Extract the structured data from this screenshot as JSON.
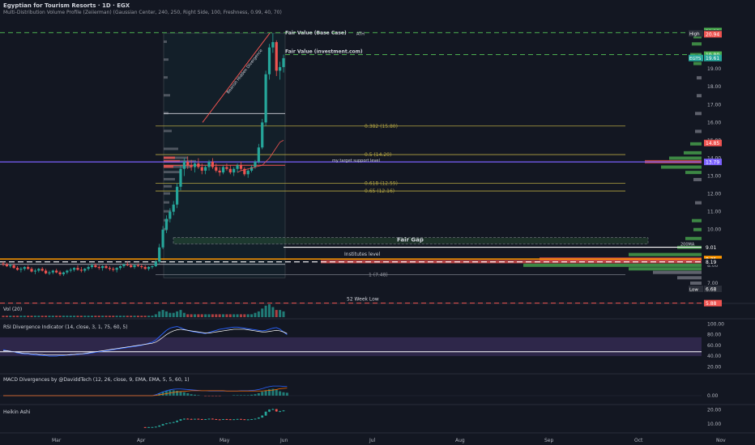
{
  "header": {
    "title": "Egyptian for Tourism Resorts · 1D · EGX",
    "indicator": "Multi-Distribution Volume Profile (Zeiierman) (Gaussian Center, 240, 250, Right Side, 100, Freshness, 0.99, 40, 70)"
  },
  "colors": {
    "background": "#131722",
    "up": "#26a69a",
    "down": "#ef5350",
    "fib": "#b5a642",
    "purple_line": "#7b61ff",
    "orange_line": "#ff9800",
    "green_dash": "#4caf50",
    "red_dash": "#ef5350"
  },
  "chart_data": [
    {
      "type": "candlestick",
      "panel": "price",
      "x_tick_labels": [
        "Mar",
        "Apr",
        "May",
        "Jun",
        "Jul",
        "Aug",
        "Sep",
        "Oct",
        "Nov"
      ],
      "ylim": [
        6.0,
        21.5
      ],
      "y_ticks": [
        7.0,
        8.0,
        9.0,
        10.0,
        11.0,
        12.0,
        13.0,
        14.0,
        15.0,
        16.0,
        17.0,
        18.0,
        19.0
      ],
      "candles": [
        [
          8.1,
          8.2,
          7.95,
          8.05
        ],
        [
          8.05,
          8.15,
          7.9,
          7.95
        ],
        [
          7.95,
          8.1,
          7.85,
          8.0
        ],
        [
          8.0,
          8.1,
          7.8,
          7.85
        ],
        [
          7.85,
          7.95,
          7.7,
          7.75
        ],
        [
          7.75,
          7.9,
          7.6,
          7.8
        ],
        [
          7.8,
          7.95,
          7.7,
          7.9
        ],
        [
          7.9,
          8.0,
          7.75,
          7.8
        ],
        [
          7.8,
          7.9,
          7.6,
          7.65
        ],
        [
          7.65,
          7.8,
          7.5,
          7.7
        ],
        [
          7.7,
          7.85,
          7.6,
          7.8
        ],
        [
          7.8,
          7.9,
          7.65,
          7.7
        ],
        [
          7.7,
          7.8,
          7.5,
          7.55
        ],
        [
          7.55,
          7.7,
          7.45,
          7.6
        ],
        [
          7.6,
          7.75,
          7.5,
          7.7
        ],
        [
          7.7,
          7.8,
          7.55,
          7.6
        ],
        [
          7.6,
          7.7,
          7.4,
          7.5
        ],
        [
          7.5,
          7.65,
          7.4,
          7.6
        ],
        [
          7.6,
          7.75,
          7.5,
          7.7
        ],
        [
          7.7,
          7.85,
          7.6,
          7.75
        ],
        [
          7.75,
          7.9,
          7.65,
          7.85
        ],
        [
          7.85,
          8.0,
          7.7,
          7.75
        ],
        [
          7.75,
          7.9,
          7.6,
          7.7
        ],
        [
          7.7,
          7.85,
          7.6,
          7.8
        ],
        [
          7.8,
          8.0,
          7.7,
          7.9
        ],
        [
          7.9,
          8.1,
          7.8,
          8.0
        ],
        [
          8.0,
          8.1,
          7.85,
          7.9
        ],
        [
          7.9,
          8.0,
          7.75,
          7.85
        ],
        [
          7.85,
          8.0,
          7.7,
          7.95
        ],
        [
          7.95,
          8.05,
          7.8,
          7.85
        ],
        [
          7.85,
          7.95,
          7.7,
          7.8
        ],
        [
          7.8,
          7.9,
          7.65,
          7.75
        ],
        [
          7.75,
          7.9,
          7.6,
          7.85
        ],
        [
          7.85,
          8.0,
          7.75,
          7.95
        ],
        [
          7.95,
          8.1,
          7.85,
          8.05
        ],
        [
          8.05,
          8.2,
          7.95,
          8.0
        ],
        [
          8.0,
          8.1,
          7.85,
          7.9
        ],
        [
          7.9,
          8.05,
          7.8,
          8.0
        ],
        [
          8.0,
          8.1,
          7.9,
          7.95
        ],
        [
          7.95,
          8.05,
          7.8,
          7.9
        ],
        [
          7.9,
          8.0,
          7.75,
          7.8
        ],
        [
          7.8,
          7.95,
          7.7,
          7.9
        ],
        [
          7.9,
          8.0,
          7.8,
          7.95
        ],
        [
          7.95,
          8.3,
          7.9,
          8.2
        ],
        [
          8.2,
          9.2,
          8.1,
          9.0
        ],
        [
          9.0,
          10.2,
          8.9,
          10.0
        ],
        [
          10.0,
          10.8,
          9.8,
          10.6
        ],
        [
          10.6,
          11.2,
          10.4,
          11.0
        ],
        [
          11.0,
          11.6,
          10.8,
          11.4
        ],
        [
          11.4,
          12.6,
          11.2,
          12.4
        ],
        [
          12.4,
          13.6,
          12.2,
          13.4
        ],
        [
          13.4,
          14.0,
          13.0,
          13.8
        ],
        [
          13.8,
          14.1,
          13.4,
          13.6
        ],
        [
          13.6,
          13.9,
          13.3,
          13.5
        ],
        [
          13.5,
          13.8,
          13.2,
          13.7
        ],
        [
          13.7,
          14.0,
          13.4,
          13.5
        ],
        [
          13.5,
          13.7,
          13.1,
          13.3
        ],
        [
          13.3,
          13.6,
          13.1,
          13.5
        ],
        [
          13.5,
          13.9,
          13.3,
          13.8
        ],
        [
          13.8,
          14.0,
          13.4,
          13.5
        ],
        [
          13.5,
          13.7,
          13.2,
          13.3
        ],
        [
          13.3,
          13.5,
          13.0,
          13.2
        ],
        [
          13.2,
          13.6,
          13.1,
          13.5
        ],
        [
          13.5,
          13.7,
          13.3,
          13.4
        ],
        [
          13.4,
          13.6,
          13.1,
          13.2
        ],
        [
          13.2,
          13.5,
          13.0,
          13.4
        ],
        [
          13.4,
          13.7,
          13.2,
          13.6
        ],
        [
          13.6,
          13.8,
          13.3,
          13.4
        ],
        [
          13.4,
          13.5,
          13.0,
          13.1
        ],
        [
          13.1,
          13.4,
          12.9,
          13.3
        ],
        [
          13.3,
          13.6,
          13.2,
          13.5
        ],
        [
          13.5,
          13.9,
          13.4,
          13.8
        ],
        [
          13.8,
          14.8,
          13.7,
          14.6
        ],
        [
          14.6,
          16.2,
          14.5,
          16.0
        ],
        [
          16.0,
          18.9,
          15.8,
          18.7
        ],
        [
          18.7,
          20.4,
          18.4,
          20.2
        ],
        [
          20.2,
          21.0,
          19.9,
          20.5
        ],
        [
          20.5,
          20.6,
          18.6,
          18.9
        ],
        [
          18.9,
          19.4,
          18.4,
          19.1
        ],
        [
          19.1,
          19.8,
          18.8,
          19.6
        ]
      ],
      "ma_values": [
        13.2,
        13.3,
        13.35,
        13.4,
        13.45,
        13.5,
        13.55,
        13.6,
        13.8,
        14.0,
        14.3,
        14.6,
        14.9,
        15.0
      ],
      "ma_start_index": 66,
      "levels": {
        "ath": {
          "value": 21.03,
          "label": "ATH"
        },
        "fair_value_base": {
          "value": 20.99,
          "label": "Fair Value (Base Case)"
        },
        "fair_value_inv": {
          "value": 19.8,
          "label": "Fair Value (investment.com)"
        },
        "level_16_5": {
          "value": 16.5
        },
        "fib_382": {
          "value": 15.8,
          "label": "0.382 (15.80)"
        },
        "fib_5": {
          "value": 14.2,
          "label": "0.5 (14.20)"
        },
        "purple": {
          "value": 13.79,
          "label": "my target support level"
        },
        "fib_618": {
          "value": 12.59,
          "label": "0.618 (12.59)"
        },
        "fib_65": {
          "value": 12.16,
          "label": "0.65 (12.16)"
        },
        "fair_gap": {
          "low": 9.2,
          "high": 9.55,
          "label": "Fair Gap"
        },
        "ma200": {
          "value": 9.01,
          "label": "200MA"
        },
        "institutes": {
          "value": 8.35,
          "label": "Institutes level"
        },
        "white_dash": {
          "value": 8.19
        },
        "fib_1": {
          "value": 7.48,
          "label": "1 (7.48)"
        },
        "low": {
          "value": 6.68
        },
        "week52_low": {
          "value": 5.88,
          "label": "52 Week Low"
        }
      },
      "divergence_label": "Bearish Hidden Divergence",
      "price_tags": [
        {
          "value": 21.12,
          "text": "21.12",
          "color": "#4caf50"
        },
        {
          "value": 21.03,
          "text": "21.03",
          "color": "#4caf50"
        },
        {
          "value": 20.99,
          "text": "20.99",
          "color": "#2a2e39",
          "prefix": "High"
        },
        {
          "value": 20.94,
          "text": "20.94",
          "color": "#ef5350"
        },
        {
          "value": 19.8,
          "text": "19.80",
          "color": "#4caf50"
        },
        {
          "value": 19.61,
          "text": "19.61",
          "color": "#26a69a",
          "prefix": "EGTS"
        },
        {
          "value": 14.85,
          "text": "14.85",
          "color": "#ef5350"
        },
        {
          "value": 13.79,
          "text": "13.79",
          "color": "#7b61ff"
        },
        {
          "value": 9.01,
          "text": "9.01",
          "color": "#131722"
        },
        {
          "value": 8.35,
          "text": "8.35",
          "color": "#ff9800"
        },
        {
          "value": 8.19,
          "text": "8.19",
          "color": "#131722"
        },
        {
          "value": 6.68,
          "text": "6.68",
          "color": "#2a2e39",
          "prefix": "Low"
        },
        {
          "value": 5.88,
          "text": "5.88",
          "color": "#ef5350"
        }
      ]
    },
    {
      "type": "bar",
      "panel": "volume",
      "title": "Vol (20)",
      "values": [
        1,
        1,
        1,
        1,
        1,
        1,
        1,
        1,
        1,
        1,
        1,
        1,
        1,
        1,
        1,
        1,
        1,
        1,
        1,
        1,
        1,
        1,
        1,
        1,
        1,
        1,
        1,
        1,
        1,
        1,
        1,
        1,
        1,
        1,
        1,
        1,
        1,
        1,
        1,
        1,
        1,
        1,
        1,
        2,
        4,
        5,
        4,
        3,
        3,
        4,
        5,
        3,
        2,
        2,
        2,
        2,
        2,
        2,
        2,
        2,
        2,
        2,
        2,
        2,
        2,
        2,
        2,
        2,
        2,
        2,
        2,
        3,
        4,
        6,
        8,
        9,
        7,
        5,
        5,
        4
      ]
    },
    {
      "type": "line",
      "panel": "rsi",
      "title": "RSI Divergence Indicator (14, close, 3, 1, 75, 60, 5)",
      "y_ticks": [
        20.0,
        40.0,
        60.0,
        80.0,
        100.0
      ],
      "ylim": [
        10,
        105
      ],
      "band": [
        40,
        75
      ],
      "threshold": 48,
      "rsi_values": [
        52,
        50,
        49,
        48,
        46,
        45,
        44,
        44,
        43,
        42,
        42,
        41,
        41,
        40,
        40,
        40,
        41,
        41,
        42,
        42,
        43,
        43,
        44,
        44,
        45,
        46,
        47,
        48,
        49,
        50,
        51,
        52,
        53,
        54,
        55,
        56,
        57,
        58,
        59,
        60,
        62,
        64,
        66,
        70,
        76,
        82,
        88,
        92,
        94,
        95,
        93,
        90,
        88,
        86,
        85,
        84,
        83,
        82,
        84,
        86,
        88,
        90,
        91,
        92,
        93,
        94,
        94,
        93,
        92,
        91,
        90,
        89,
        88,
        87,
        88,
        90,
        92,
        93,
        90,
        85,
        80
      ],
      "ma_values": [
        50,
        50,
        49,
        48,
        47,
        46,
        45,
        45,
        44,
        44,
        43,
        43,
        42,
        42,
        42,
        42,
        42,
        42,
        42,
        43,
        43,
        44,
        44,
        45,
        46,
        47,
        48,
        49,
        50,
        51,
        52,
        53,
        54,
        55,
        56,
        57,
        58,
        59,
        60,
        61,
        62,
        63,
        64,
        66,
        70,
        75,
        80,
        84,
        87,
        89,
        90,
        89,
        88,
        87,
        86,
        85,
        84,
        83,
        83,
        84,
        85,
        86,
        87,
        88,
        89,
        90,
        90,
        90,
        90,
        89,
        88,
        87,
        86,
        85,
        85,
        86,
        87,
        88,
        87,
        85,
        82
      ]
    },
    {
      "type": "line",
      "panel": "macd",
      "title": "MACD Divergences by @DaviddTech (12, 26, close, 9, EMA, EMA, 5, 5, 60, 1)",
      "histogram": [
        0,
        0,
        0,
        0,
        0,
        0,
        0,
        0,
        0,
        0,
        0,
        0,
        0,
        0,
        0,
        0,
        0,
        0,
        0,
        0,
        0,
        0,
        0,
        0,
        0,
        0,
        0,
        0,
        0,
        0,
        0,
        0,
        0,
        0,
        0,
        0,
        0,
        0,
        0,
        0,
        0,
        0,
        0,
        0.2,
        0.5,
        0.8,
        1.0,
        1.1,
        1.1,
        1.0,
        0.9,
        0.7,
        0.5,
        0.3,
        0.2,
        0.1,
        0.0,
        -0.1,
        -0.1,
        -0.1,
        -0.1,
        -0.1,
        0.0,
        0.0,
        0.0,
        0.1,
        0.1,
        0.1,
        0.1,
        0.1,
        0.2,
        0.3,
        0.5,
        0.8,
        1.1,
        1.3,
        1.4,
        1.2,
        0.9,
        0.7,
        0.6
      ],
      "macd_values": [
        0,
        0,
        0,
        0,
        0,
        0,
        0,
        0,
        0,
        0,
        0,
        0,
        0,
        0,
        0,
        0,
        0,
        0,
        0,
        0,
        0,
        0,
        0,
        0,
        0,
        0,
        0,
        0,
        0,
        0,
        0,
        0,
        0,
        0,
        0,
        0,
        0,
        0,
        0,
        0,
        0,
        0,
        0,
        0.3,
        0.8,
        1.3,
        1.7,
        2.0,
        2.2,
        2.3,
        2.3,
        2.2,
        2.1,
        2.0,
        1.9,
        1.8,
        1.7,
        1.7,
        1.6,
        1.6,
        1.6,
        1.6,
        1.6,
        1.6,
        1.6,
        1.6,
        1.6,
        1.7,
        1.7,
        1.7,
        1.8,
        1.9,
        2.1,
        2.4,
        2.8,
        3.1,
        3.3,
        3.3,
        3.3,
        3.2,
        3.2
      ],
      "signal_values": [
        0,
        0,
        0,
        0,
        0,
        0,
        0,
        0,
        0,
        0,
        0,
        0,
        0,
        0,
        0,
        0,
        0,
        0,
        0,
        0,
        0,
        0,
        0,
        0,
        0,
        0,
        0,
        0,
        0,
        0,
        0,
        0,
        0,
        0,
        0,
        0,
        0,
        0,
        0,
        0,
        0,
        0,
        0,
        0.1,
        0.3,
        0.5,
        0.7,
        0.9,
        1.1,
        1.3,
        1.4,
        1.5,
        1.6,
        1.7,
        1.7,
        1.7,
        1.7,
        1.7,
        1.7,
        1.7,
        1.7,
        1.7,
        1.7,
        1.6,
        1.6,
        1.6,
        1.6,
        1.6,
        1.6,
        1.6,
        1.6,
        1.6,
        1.6,
        1.6,
        1.7,
        1.8,
        1.9,
        2.1,
        2.4,
        2.5,
        2.6
      ],
      "y_ticks": [
        "0.00"
      ]
    },
    {
      "type": "candlestick",
      "panel": "heikin",
      "title": "Heikin Ashi",
      "y_ticks": [
        10.0,
        20.0
      ]
    }
  ]
}
